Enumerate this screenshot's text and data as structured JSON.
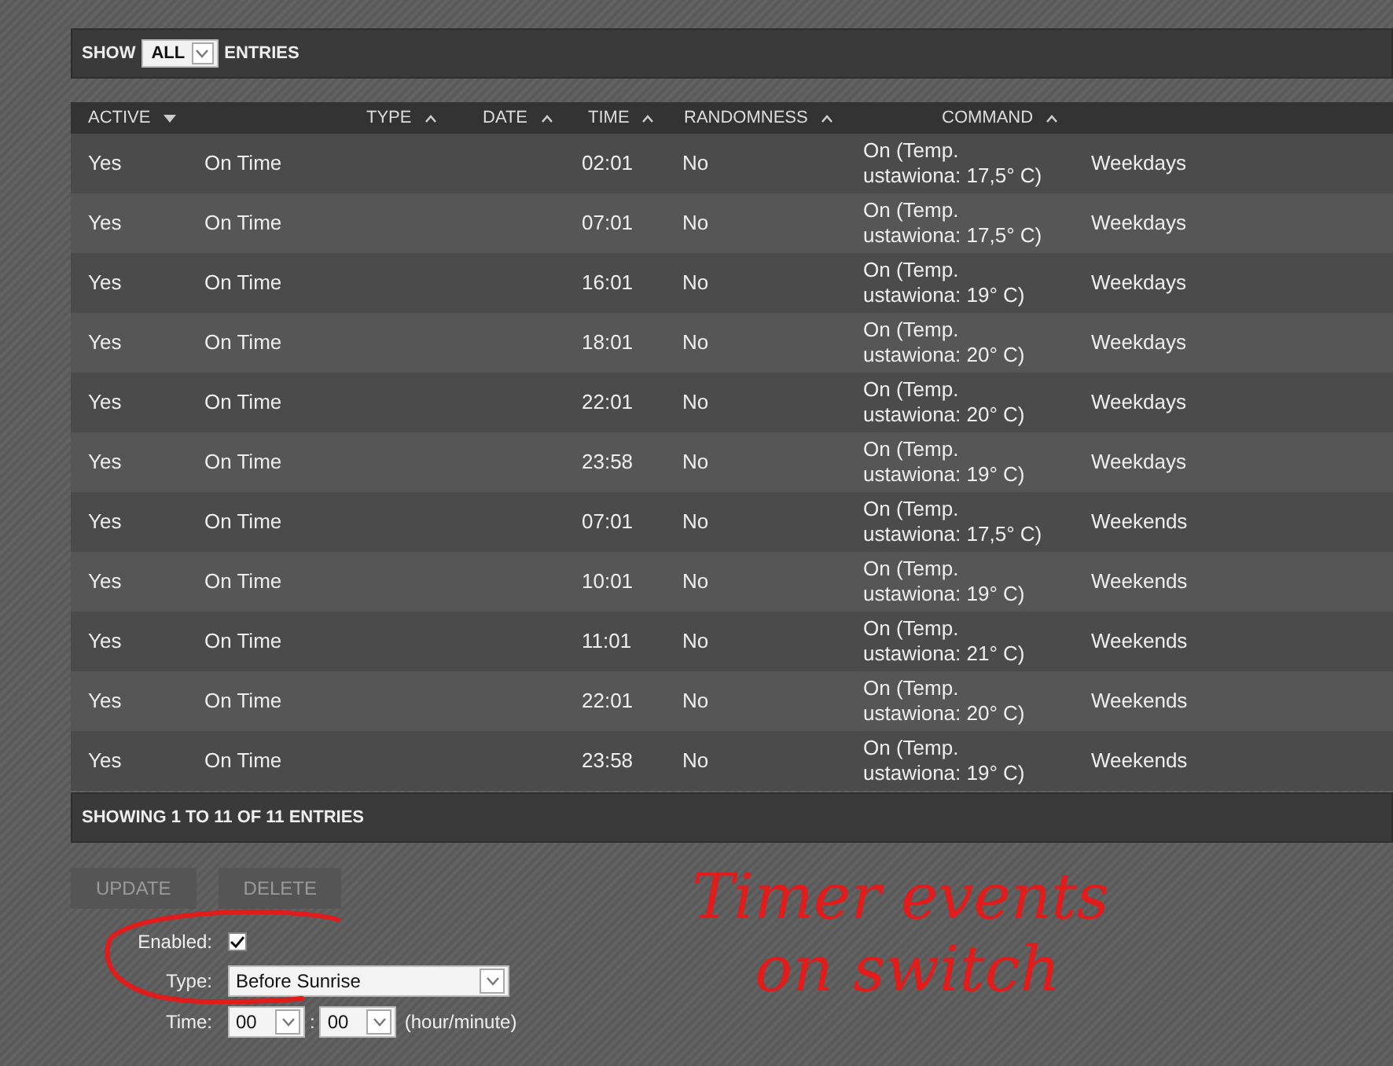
{
  "length_control": {
    "prefix": "SHOW",
    "value": "ALL",
    "suffix": "ENTRIES"
  },
  "table": {
    "columns": [
      {
        "label": "ACTIVE",
        "sorted": true
      },
      {
        "label": "TYPE",
        "sorted": false
      },
      {
        "label": "DATE",
        "sorted": false
      },
      {
        "label": "TIME",
        "sorted": false
      },
      {
        "label": "RANDOMNESS",
        "sorted": false
      },
      {
        "label": "COMMAND",
        "sorted": false
      }
    ],
    "rows": [
      {
        "active": "Yes",
        "type": "On Time",
        "time": "02:01",
        "randomness": "No",
        "command": "On (Temp.\nustawiona: 17,5° C)",
        "days": "Weekdays"
      },
      {
        "active": "Yes",
        "type": "On Time",
        "time": "07:01",
        "randomness": "No",
        "command": "On (Temp.\nustawiona: 17,5° C)",
        "days": "Weekdays"
      },
      {
        "active": "Yes",
        "type": "On Time",
        "time": "16:01",
        "randomness": "No",
        "command": "On (Temp.\nustawiona: 19° C)",
        "days": "Weekdays"
      },
      {
        "active": "Yes",
        "type": "On Time",
        "time": "18:01",
        "randomness": "No",
        "command": "On (Temp.\nustawiona: 20° C)",
        "days": "Weekdays"
      },
      {
        "active": "Yes",
        "type": "On Time",
        "time": "22:01",
        "randomness": "No",
        "command": "On (Temp.\nustawiona: 20° C)",
        "days": "Weekdays"
      },
      {
        "active": "Yes",
        "type": "On Time",
        "time": "23:58",
        "randomness": "No",
        "command": "On (Temp.\nustawiona: 19° C)",
        "days": "Weekdays"
      },
      {
        "active": "Yes",
        "type": "On Time",
        "time": "07:01",
        "randomness": "No",
        "command": "On (Temp.\nustawiona: 17,5° C)",
        "days": "Weekends"
      },
      {
        "active": "Yes",
        "type": "On Time",
        "time": "10:01",
        "randomness": "No",
        "command": "On (Temp.\nustawiona: 19° C)",
        "days": "Weekends"
      },
      {
        "active": "Yes",
        "type": "On Time",
        "time": "11:01",
        "randomness": "No",
        "command": "On (Temp.\nustawiona: 21° C)",
        "days": "Weekends"
      },
      {
        "active": "Yes",
        "type": "On Time",
        "time": "22:01",
        "randomness": "No",
        "command": "On (Temp.\nustawiona: 20° C)",
        "days": "Weekends"
      },
      {
        "active": "Yes",
        "type": "On Time",
        "time": "23:58",
        "randomness": "No",
        "command": "On (Temp.\nustawiona: 19° C)",
        "days": "Weekends"
      }
    ]
  },
  "table_info": "SHOWING 1 TO 11 OF 11 ENTRIES",
  "buttons": [
    {
      "label": "UPDATE",
      "disabled": true
    },
    {
      "label": "DELETE",
      "disabled": true
    }
  ],
  "form": {
    "enabled": {
      "label": "Enabled:",
      "checked": true
    },
    "type": {
      "label": "Type:",
      "value": "Before Sunrise"
    },
    "time": {
      "label": "Time:",
      "hour": "00",
      "separator": ":",
      "minute": "00",
      "hint": "(hour/minute)"
    }
  },
  "annotation": {
    "lines": [
      "Timer events",
      "on switch"
    ]
  }
}
